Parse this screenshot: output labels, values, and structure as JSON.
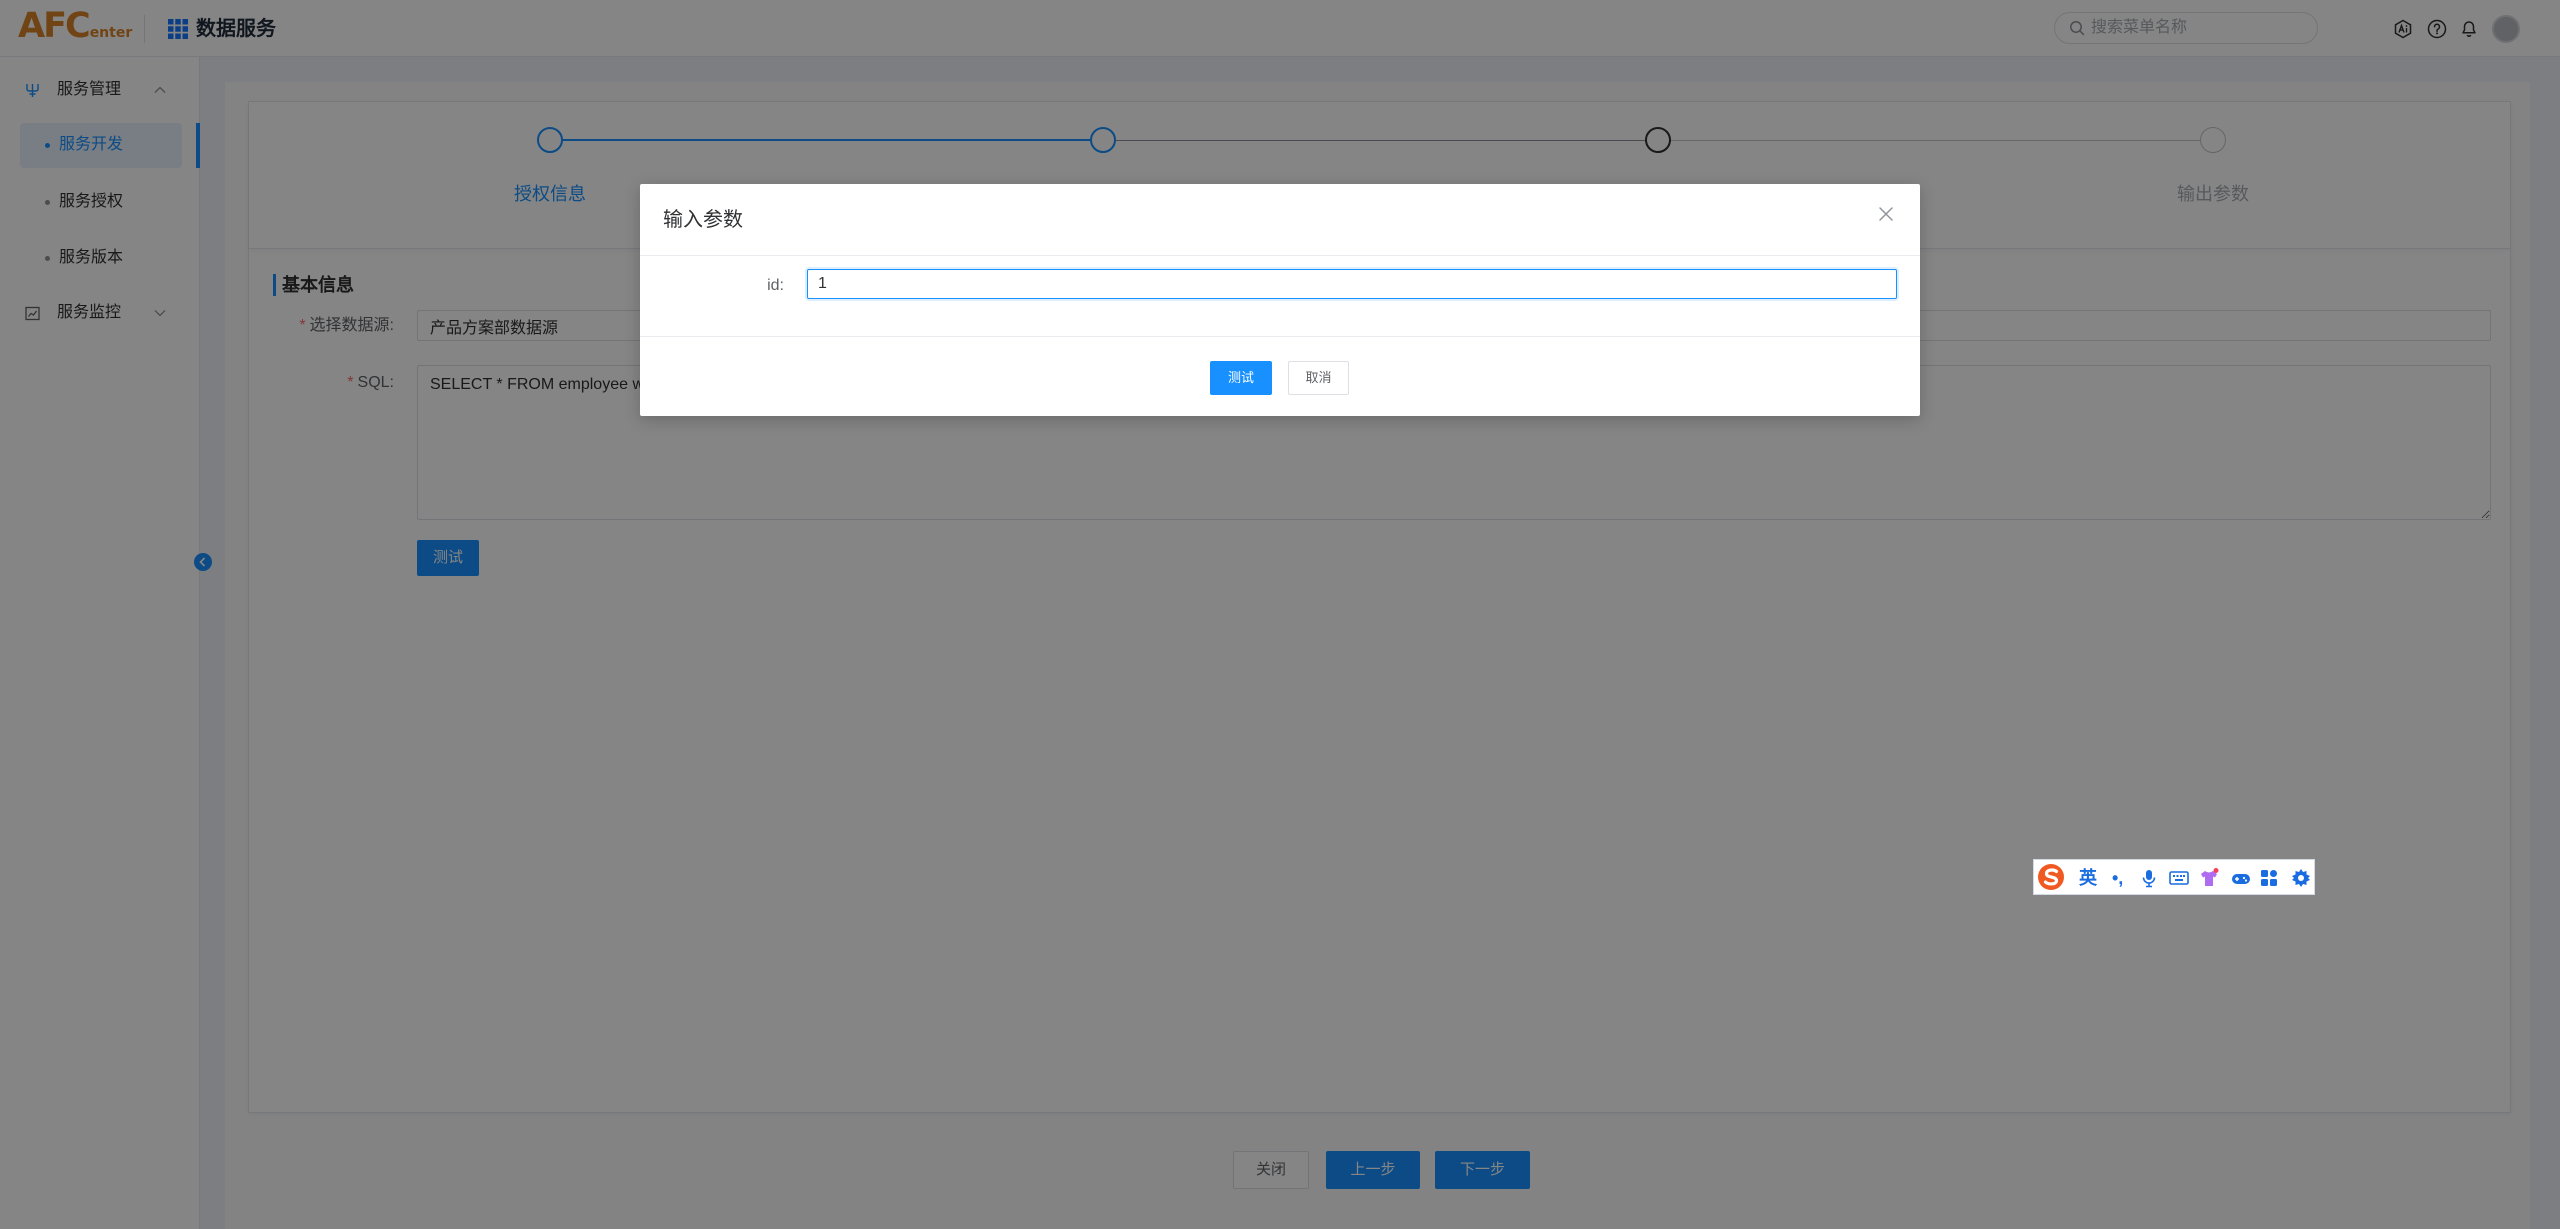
{
  "header": {
    "logo": {
      "main": "AFC",
      "sub": "enter"
    },
    "app_title": "数据服务",
    "search_placeholder": "搜索菜单名称",
    "icons": [
      "apps-grid-icon",
      "search-icon",
      "ai-assistant-icon",
      "help-icon",
      "bell-icon"
    ]
  },
  "sidebar": {
    "groups": [
      {
        "label": "服务管理",
        "expanded": true,
        "items": [
          {
            "label": "服务开发",
            "active": true
          },
          {
            "label": "服务授权",
            "active": false
          },
          {
            "label": "服务版本",
            "active": false
          }
        ]
      },
      {
        "label": "服务监控",
        "expanded": false
      }
    ]
  },
  "steps": {
    "current_step": 3,
    "total": 4,
    "items": [
      {
        "label": "授权信息"
      },
      {},
      {},
      {
        "label": "输出参数"
      }
    ]
  },
  "form": {
    "section_title": "基本信息",
    "required_mark": "*",
    "datasource": {
      "label": "选择数据源:",
      "value": "产品方案部数据源"
    },
    "sql": {
      "label": "SQL:",
      "value": "SELECT * FROM employee wh"
    },
    "test_button": "测试"
  },
  "footer": {
    "close": "关闭",
    "prev": "上一步",
    "next": "下一步"
  },
  "modal": {
    "title": "输入参数",
    "params": [
      {
        "label": "id:",
        "value": "1"
      }
    ],
    "confirm": "测试",
    "cancel": "取消"
  },
  "ime": {
    "lang": "英",
    "punct": "•,"
  },
  "colors": {
    "primary": "#1890ff",
    "logo": "#d9822b",
    "required": "#f56c6c",
    "ime_logo": "#f05a22"
  }
}
